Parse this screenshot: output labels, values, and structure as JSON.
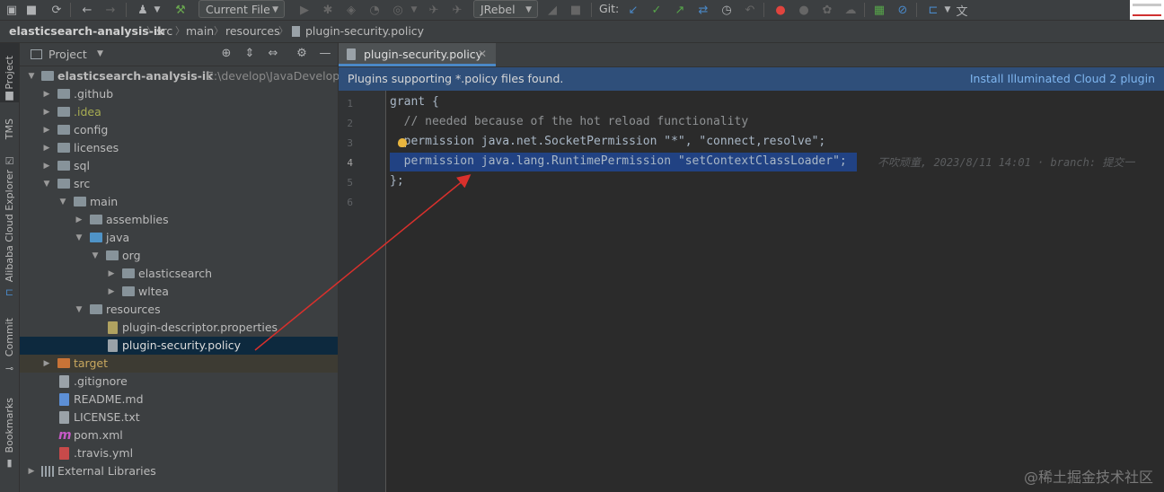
{
  "toolbar": {
    "run_config": "Current File",
    "jrebel": "JRebel",
    "git_label": "Git:",
    "icons": [
      "save-icon",
      "sync-icon",
      "back-icon",
      "forward-icon",
      "user-icon",
      "build-hammer-icon",
      "run-icon",
      "debug-icon",
      "coverage-icon",
      "profile-icon",
      "stop-icon",
      "jrebel-icon",
      "vcs-update-icon",
      "vcs-commit-icon",
      "vcs-push-icon",
      "vcs-fetch-icon",
      "history-icon",
      "rollback-icon",
      "cloud-icon",
      "translate-icon"
    ]
  },
  "breadcrumb": {
    "items": [
      "elasticsearch-analysis-ik",
      "src",
      "main",
      "resources",
      "plugin-security.policy"
    ]
  },
  "left_strip": {
    "tabs": [
      "Project",
      "TMS",
      "Alibaba Cloud Explorer",
      "Commit",
      "Bookmarks"
    ]
  },
  "project_panel": {
    "title": "Project",
    "root_name": "elasticsearch-analysis-ik",
    "root_path": "E:\\develop\\JavaDevelop\\",
    "tree": [
      {
        "label": ".github"
      },
      {
        "label": ".idea"
      },
      {
        "label": "config"
      },
      {
        "label": "licenses"
      },
      {
        "label": "sql"
      },
      {
        "label": "src"
      },
      {
        "label": "main"
      },
      {
        "label": "assemblies"
      },
      {
        "label": "java"
      },
      {
        "label": "org"
      },
      {
        "label": "elasticsearch"
      },
      {
        "label": "wltea"
      },
      {
        "label": "resources"
      },
      {
        "label": "plugin-descriptor.properties"
      },
      {
        "label": "plugin-security.policy"
      },
      {
        "label": "target"
      },
      {
        "label": ".gitignore"
      },
      {
        "label": "README.md"
      },
      {
        "label": "LICENSE.txt"
      },
      {
        "label": "pom.xml"
      },
      {
        "label": ".travis.yml"
      },
      {
        "label": "External Libraries"
      }
    ]
  },
  "editor": {
    "tab_label": "plugin-security.policy",
    "banner_text": "Plugins supporting *.policy files found.",
    "banner_link": "Install Illuminated Cloud 2 plugin",
    "line_numbers": [
      "1",
      "2",
      "3",
      "4",
      "5",
      "6"
    ],
    "lines": [
      "grant {",
      "  // needed because of the hot reload functionality",
      "  permission java.net.SocketPermission \"*\", \"connect,resolve\";",
      "  permission java.lang.RuntimePermission \"setContextClassLoader\";",
      "};",
      ""
    ],
    "blame": "不吹顽童, 2023/8/11 14:01 · branch: 提交一"
  },
  "watermark": "@稀土掘金技术社区",
  "colors": {
    "accent": "#4a88c7",
    "selection": "#214283",
    "banner": "#2f4f7a",
    "arrow": "#d9302c"
  }
}
